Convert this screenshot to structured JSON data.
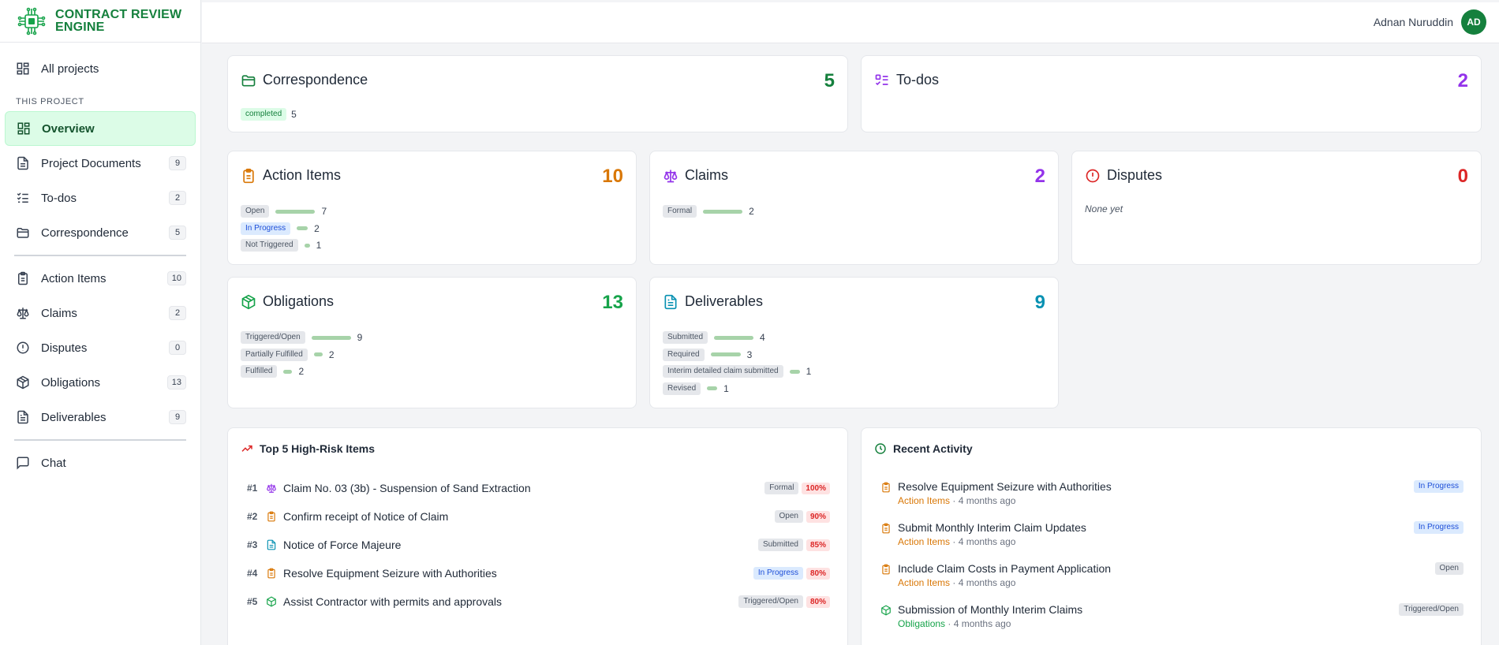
{
  "brand": {
    "line1": "CONTRACT REVIEW",
    "line2": "ENGINE"
  },
  "user": {
    "name": "Adnan Nuruddin",
    "initials": "AD"
  },
  "sidebar": {
    "all_projects": "All projects",
    "section_label": "THIS PROJECT",
    "items": [
      {
        "label": "Overview",
        "count": "",
        "icon": "grid-icon"
      },
      {
        "label": "Project Documents",
        "count": "9",
        "icon": "document-icon"
      },
      {
        "label": "To-dos",
        "count": "2",
        "icon": "checklist-icon"
      },
      {
        "label": "Correspondence",
        "count": "5",
        "icon": "folder-icon"
      },
      {
        "label": "Action Items",
        "count": "10",
        "icon": "clipboard-icon"
      },
      {
        "label": "Claims",
        "count": "2",
        "icon": "scale-icon"
      },
      {
        "label": "Disputes",
        "count": "0",
        "icon": "alert-circle-icon"
      },
      {
        "label": "Obligations",
        "count": "13",
        "icon": "package-icon"
      },
      {
        "label": "Deliverables",
        "count": "9",
        "icon": "file-text-icon"
      }
    ],
    "chat": "Chat"
  },
  "cards": {
    "correspondence": {
      "title": "Correspondence",
      "count": "5",
      "color": "#15803d",
      "statuses": [
        {
          "label": "completed",
          "value": "5",
          "max": 5
        }
      ]
    },
    "todos": {
      "title": "To-dos",
      "count": "2",
      "color": "#9333ea"
    },
    "action_items": {
      "title": "Action Items",
      "count": "10",
      "color": "#d97706",
      "statuses": [
        {
          "label": "Open",
          "value": "7",
          "max": 7
        },
        {
          "label": "In Progress",
          "value": "2",
          "max": 7
        },
        {
          "label": "Not Triggered",
          "value": "1",
          "max": 7
        }
      ]
    },
    "claims": {
      "title": "Claims",
      "count": "2",
      "color": "#9333ea",
      "statuses": [
        {
          "label": "Formal",
          "value": "2",
          "max": 2
        }
      ]
    },
    "disputes": {
      "title": "Disputes",
      "count": "0",
      "color": "#dc2626",
      "empty": "None yet"
    },
    "obligations": {
      "title": "Obligations",
      "count": "13",
      "color": "#16a34a",
      "statuses": [
        {
          "label": "Triggered/Open",
          "value": "9",
          "max": 9
        },
        {
          "label": "Partially Fulfilled",
          "value": "2",
          "max": 9
        },
        {
          "label": "Fulfilled",
          "value": "2",
          "max": 9
        }
      ]
    },
    "deliverables": {
      "title": "Deliverables",
      "count": "9",
      "color": "#0891b2",
      "statuses": [
        {
          "label": "Submitted",
          "value": "4",
          "max": 4
        },
        {
          "label": "Required",
          "value": "3",
          "max": 4
        },
        {
          "label": "Interim detailed claim submitted",
          "value": "1",
          "max": 4
        },
        {
          "label": "Revised",
          "value": "1",
          "max": 4
        }
      ]
    }
  },
  "risk": {
    "title": "Top 5 High-Risk Items",
    "items": [
      {
        "rank": "#1",
        "title": "Claim No. 03 (3b) - Suspension of Sand Extraction",
        "status": "Formal",
        "pct": "100%"
      },
      {
        "rank": "#2",
        "title": "Confirm receipt of Notice of Claim",
        "status": "Open",
        "pct": "90%"
      },
      {
        "rank": "#3",
        "title": "Notice of Force Majeure",
        "status": "Submitted",
        "pct": "85%"
      },
      {
        "rank": "#4",
        "title": "Resolve Equipment Seizure with Authorities",
        "status": "In Progress",
        "pct": "80%"
      },
      {
        "rank": "#5",
        "title": "Assist Contractor with permits and approvals",
        "status": "Triggered/Open",
        "pct": "80%"
      }
    ]
  },
  "activity": {
    "title": "Recent Activity",
    "items": [
      {
        "title": "Resolve Equipment Seizure with Authorities",
        "source": "Action Items",
        "time": " · 4 months ago",
        "status": "In Progress"
      },
      {
        "title": "Submit Monthly Interim Claim Updates",
        "source": "Action Items",
        "time": " · 4 months ago",
        "status": "In Progress"
      },
      {
        "title": "Include Claim Costs in Payment Application",
        "source": "Action Items",
        "time": " · 4 months ago",
        "status": "Open"
      },
      {
        "title": "Submission of Monthly Interim Claims",
        "source": "Obligations",
        "time": " · 4 months ago",
        "status": "Triggered/Open"
      }
    ]
  }
}
